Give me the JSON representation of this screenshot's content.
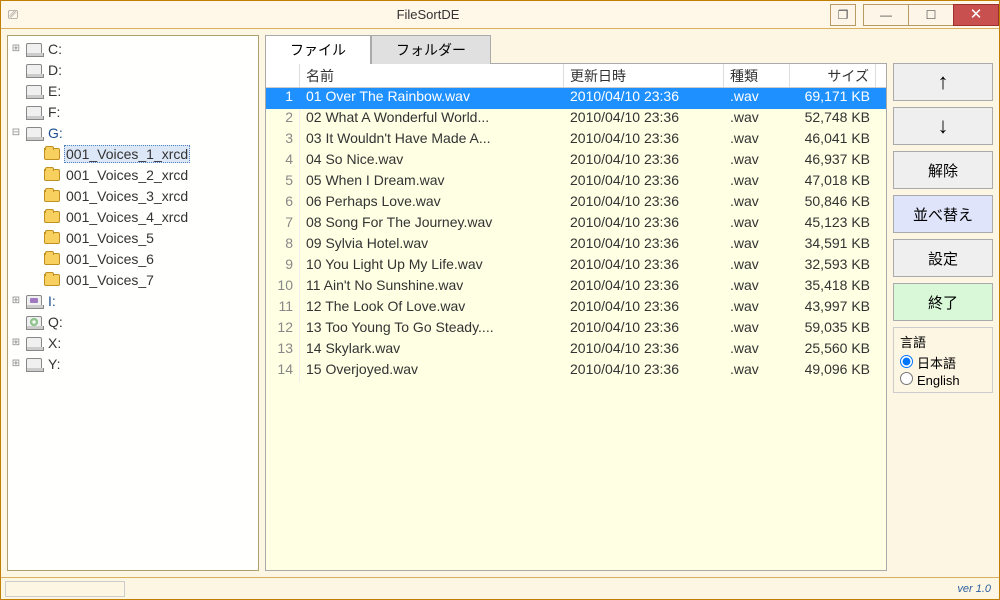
{
  "window": {
    "title": "FileSortDE"
  },
  "tabs": {
    "file": "ファイル",
    "folder": "フォルダー"
  },
  "columns": {
    "name": "名前",
    "date": "更新日時",
    "type": "種類",
    "size": "サイズ"
  },
  "tree": {
    "drives_top": [
      {
        "label": "C:",
        "exp": "+"
      },
      {
        "label": "D:",
        "exp": ""
      },
      {
        "label": "E:",
        "exp": ""
      },
      {
        "label": "F:",
        "exp": ""
      }
    ],
    "g": {
      "label": "G:",
      "exp": "-",
      "folders": [
        {
          "label": "001_Voices_1_xrcd"
        },
        {
          "label": "001_Voices_2_xrcd"
        },
        {
          "label": "001_Voices_3_xrcd"
        },
        {
          "label": "001_Voices_4_xrcd"
        },
        {
          "label": "001_Voices_5"
        },
        {
          "label": "001_Voices_6"
        },
        {
          "label": "001_Voices_7"
        }
      ]
    },
    "drives_bottom": [
      {
        "label": "I:",
        "exp": "+",
        "kind": "purple"
      },
      {
        "label": "Q:",
        "exp": "",
        "kind": "cd"
      },
      {
        "label": "X:",
        "exp": "+",
        "kind": "net"
      },
      {
        "label": "Y:",
        "exp": "+",
        "kind": "net"
      }
    ]
  },
  "files": [
    {
      "n": "1",
      "name": "01 Over The Rainbow.wav",
      "date": "2010/04/10 23:36",
      "type": ".wav",
      "size": "69,171",
      "kb": "KB",
      "sel": true
    },
    {
      "n": "2",
      "name": "02 What A Wonderful World...",
      "date": "2010/04/10 23:36",
      "type": ".wav",
      "size": "52,748",
      "kb": "KB"
    },
    {
      "n": "3",
      "name": "03 It Wouldn't Have Made A...",
      "date": "2010/04/10 23:36",
      "type": ".wav",
      "size": "46,041",
      "kb": "KB"
    },
    {
      "n": "4",
      "name": "04 So Nice.wav",
      "date": "2010/04/10 23:36",
      "type": ".wav",
      "size": "46,937",
      "kb": "KB"
    },
    {
      "n": "5",
      "name": "05 When I Dream.wav",
      "date": "2010/04/10 23:36",
      "type": ".wav",
      "size": "47,018",
      "kb": "KB"
    },
    {
      "n": "6",
      "name": "06 Perhaps Love.wav",
      "date": "2010/04/10 23:36",
      "type": ".wav",
      "size": "50,846",
      "kb": "KB"
    },
    {
      "n": "7",
      "name": "08 Song For The Journey.wav",
      "date": "2010/04/10 23:36",
      "type": ".wav",
      "size": "45,123",
      "kb": "KB"
    },
    {
      "n": "8",
      "name": "09 Sylvia Hotel.wav",
      "date": "2010/04/10 23:36",
      "type": ".wav",
      "size": "34,591",
      "kb": "KB"
    },
    {
      "n": "9",
      "name": "10 You Light Up My Life.wav",
      "date": "2010/04/10 23:36",
      "type": ".wav",
      "size": "32,593",
      "kb": "KB"
    },
    {
      "n": "10",
      "name": "11 Ain't No Sunshine.wav",
      "date": "2010/04/10 23:36",
      "type": ".wav",
      "size": "35,418",
      "kb": "KB"
    },
    {
      "n": "11",
      "name": "12 The Look Of Love.wav",
      "date": "2010/04/10 23:36",
      "type": ".wav",
      "size": "43,997",
      "kb": "KB"
    },
    {
      "n": "12",
      "name": "13 Too Young To Go Steady....",
      "date": "2010/04/10 23:36",
      "type": ".wav",
      "size": "59,035",
      "kb": "KB"
    },
    {
      "n": "13",
      "name": "14 Skylark.wav",
      "date": "2010/04/10 23:36",
      "type": ".wav",
      "size": "25,560",
      "kb": "KB"
    },
    {
      "n": "14",
      "name": "15 Overjoyed.wav",
      "date": "2010/04/10 23:36",
      "type": ".wav",
      "size": "49,096",
      "kb": "KB"
    }
  ],
  "buttons": {
    "up": "↑",
    "down": "↓",
    "unlock": "解除",
    "sort": "並べ替え",
    "settings": "設定",
    "exit": "終了"
  },
  "lang": {
    "title": "言語",
    "jp": "日本語",
    "en": "English"
  },
  "status": {
    "version": "ver 1.0"
  }
}
